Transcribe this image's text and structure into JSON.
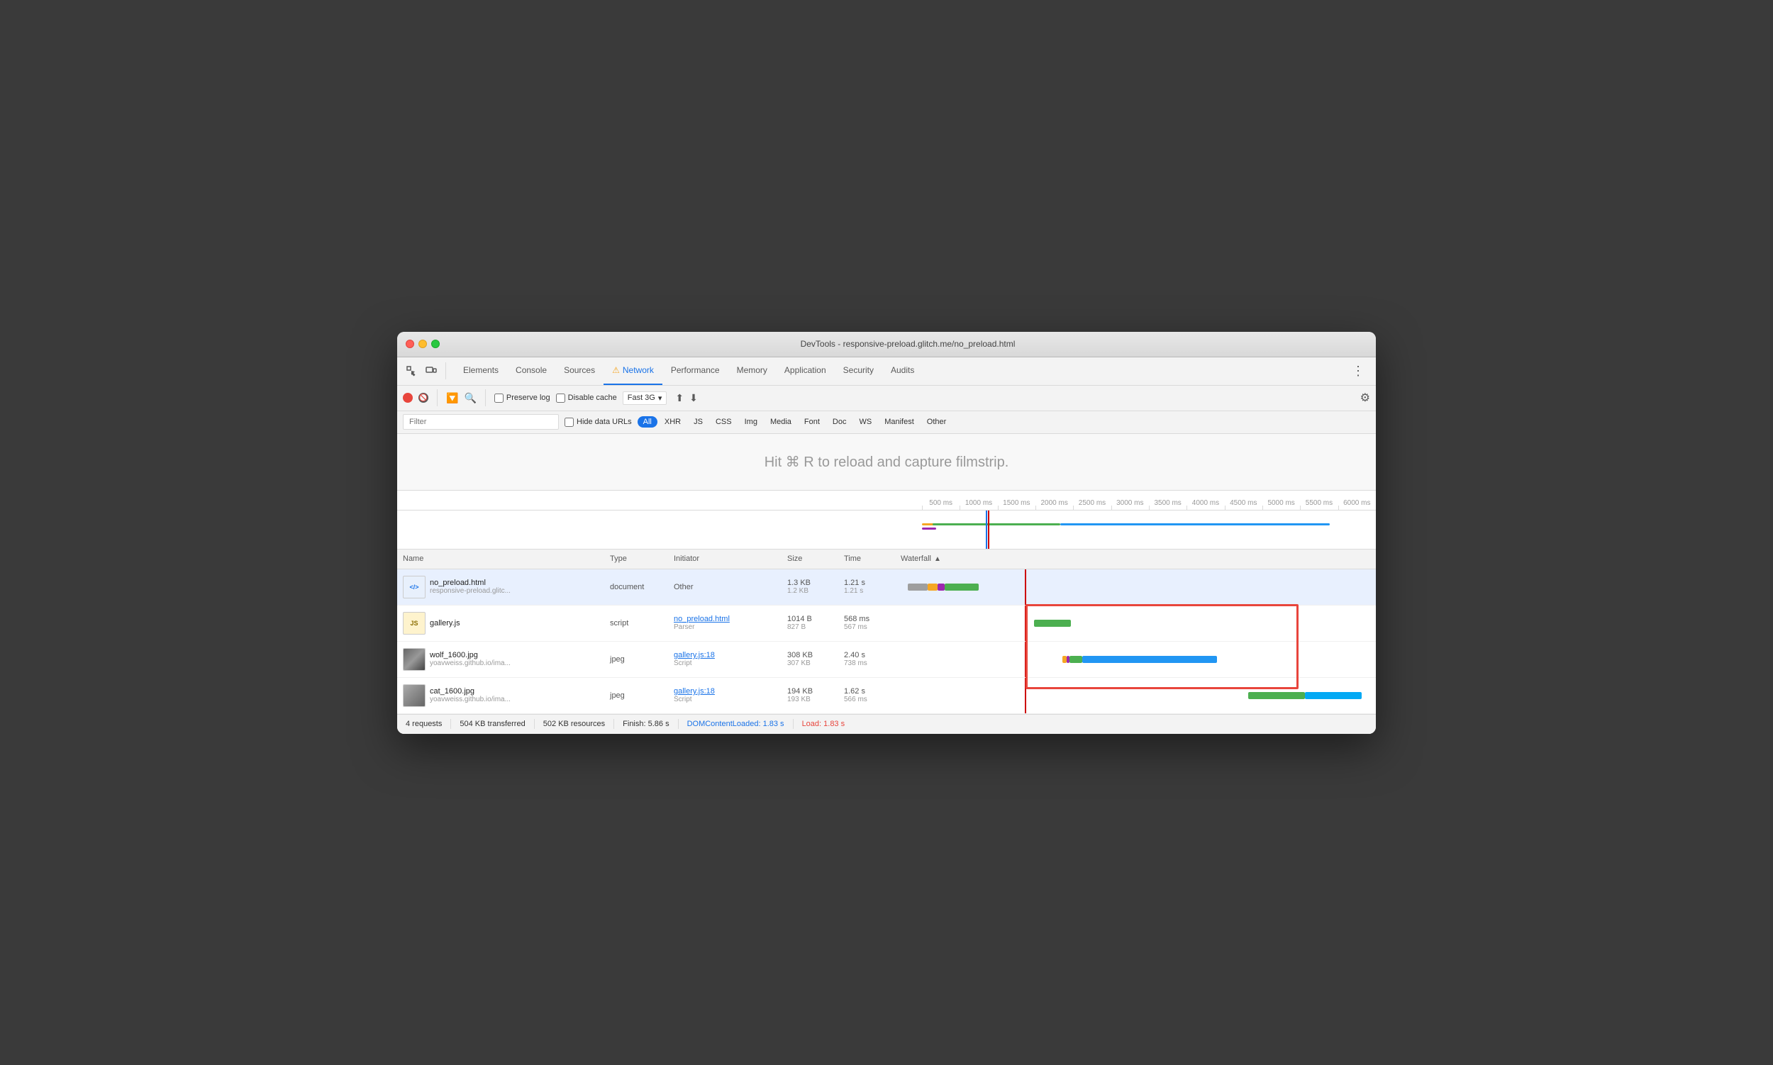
{
  "window": {
    "title": "DevTools - responsive-preload.glitch.me/no_preload.html"
  },
  "tabs": [
    {
      "id": "elements",
      "label": "Elements",
      "active": false
    },
    {
      "id": "console",
      "label": "Console",
      "active": false
    },
    {
      "id": "sources",
      "label": "Sources",
      "active": false
    },
    {
      "id": "network",
      "label": "Network",
      "active": true,
      "warning": "⚠"
    },
    {
      "id": "performance",
      "label": "Performance",
      "active": false
    },
    {
      "id": "memory",
      "label": "Memory",
      "active": false
    },
    {
      "id": "application",
      "label": "Application",
      "active": false
    },
    {
      "id": "security",
      "label": "Security",
      "active": false
    },
    {
      "id": "audits",
      "label": "Audits",
      "active": false
    }
  ],
  "toolbar2": {
    "preserve_log": "Preserve log",
    "disable_cache": "Disable cache",
    "throttle": "Fast 3G",
    "throttle_arrow": "▾"
  },
  "filter_bar": {
    "placeholder": "Filter",
    "hide_data_urls": "Hide data URLs",
    "types": [
      "All",
      "XHR",
      "JS",
      "CSS",
      "Img",
      "Media",
      "Font",
      "Doc",
      "WS",
      "Manifest",
      "Other"
    ],
    "active_type": "All"
  },
  "filmstrip": {
    "hint": "Hit ⌘ R to reload and capture filmstrip."
  },
  "timeline": {
    "ticks": [
      "500 ms",
      "1000 ms",
      "1500 ms",
      "2000 ms",
      "2500 ms",
      "3000 ms",
      "3500 ms",
      "4000 ms",
      "4500 ms",
      "5000 ms",
      "5500 ms",
      "6000 ms"
    ]
  },
  "table": {
    "headers": {
      "name": "Name",
      "type": "Type",
      "initiator": "Initiator",
      "size": "Size",
      "time": "Time",
      "waterfall": "Waterfall"
    },
    "rows": [
      {
        "name": "no_preload.html",
        "domain": "responsive-preload.glitc...",
        "type": "document",
        "initiator": "Other",
        "initiator_sub": "",
        "size": "1.3 KB",
        "size_sub": "1.2 KB",
        "time": "1.21 s",
        "time_sub": "1.21 s",
        "selected": true
      },
      {
        "name": "gallery.js",
        "domain": "",
        "type": "script",
        "initiator": "no_preload.html",
        "initiator_sub": "Parser",
        "size": "1014 B",
        "size_sub": "827 B",
        "time": "568 ms",
        "time_sub": "567 ms",
        "selected": false
      },
      {
        "name": "wolf_1600.jpg",
        "domain": "yoavweiss.github.io/ima...",
        "type": "jpeg",
        "initiator": "gallery.js:18",
        "initiator_sub": "Script",
        "size": "308 KB",
        "size_sub": "307 KB",
        "time": "2.40 s",
        "time_sub": "738 ms",
        "selected": false
      },
      {
        "name": "cat_1600.jpg",
        "domain": "yoavweiss.github.io/ima...",
        "type": "jpeg",
        "initiator": "gallery.js:18",
        "initiator_sub": "Script",
        "size": "194 KB",
        "size_sub": "193 KB",
        "time": "1.62 s",
        "time_sub": "566 ms",
        "selected": false
      }
    ]
  },
  "status_bar": {
    "requests": "4 requests",
    "transferred": "504 KB transferred",
    "resources": "502 KB resources",
    "finish": "Finish: 5.86 s",
    "dom_content_loaded": "DOMContentLoaded: 1.83 s",
    "load": "Load: 1.83 s"
  }
}
